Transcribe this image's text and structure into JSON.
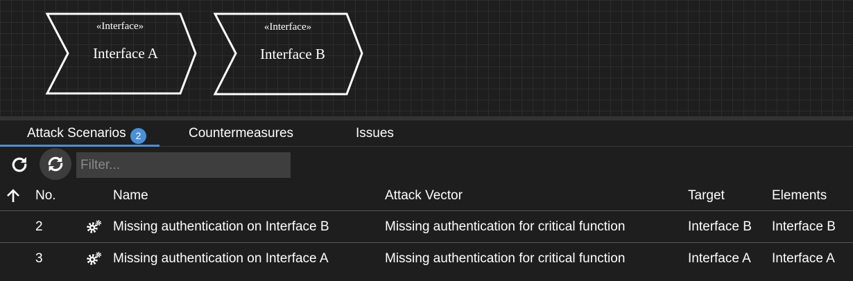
{
  "diagram": {
    "shapes": [
      {
        "stereotype": "«Interface»",
        "name": "Interface A"
      },
      {
        "stereotype": "«Interface»",
        "name": "Interface B"
      }
    ]
  },
  "tabs": {
    "attack_scenarios": "Attack Scenarios",
    "attack_scenarios_badge": "2",
    "countermeasures": "Countermeasures",
    "issues": "Issues"
  },
  "toolbar": {
    "refresh_icon": "refresh-icon",
    "sync_icon": "sync-icon",
    "filter_placeholder": "Filter...",
    "filter_value": ""
  },
  "table": {
    "sort_icon": "arrow-up-icon",
    "columns": {
      "no": "No.",
      "name": "Name",
      "attack_vector": "Attack Vector",
      "target": "Target",
      "elements": "Elements"
    },
    "rows": [
      {
        "no": "2",
        "icon": "gears-icon",
        "name": "Missing authentication on Interface B",
        "attack_vector": "Missing authentication for critical function",
        "target": "Interface B",
        "elements": "Interface B"
      },
      {
        "no": "3",
        "icon": "gears-icon",
        "name": "Missing authentication on Interface A",
        "attack_vector": "Missing authentication for critical function",
        "target": "Interface A",
        "elements": "Interface A"
      }
    ]
  },
  "colors": {
    "background": "#1e1e1e",
    "accent": "#4a90d9",
    "grid": "#2c2c2c"
  }
}
